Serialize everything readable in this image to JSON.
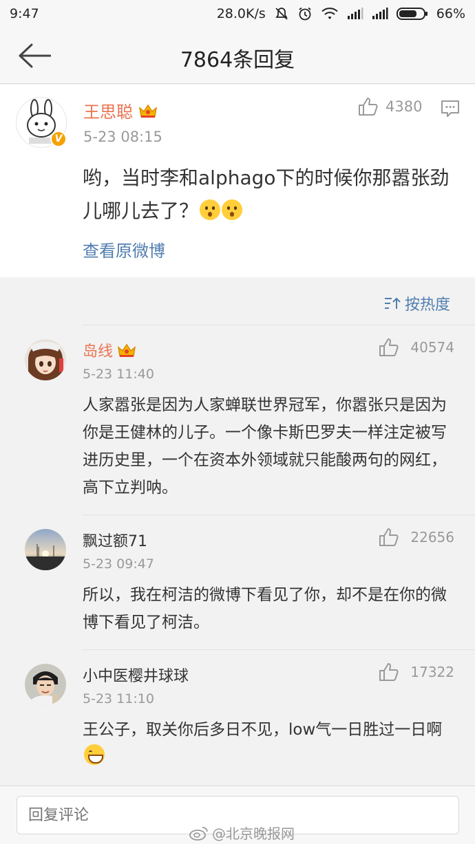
{
  "status_bar": {
    "time": "9:47",
    "network_speed": "28.0K/s",
    "battery": "66%"
  },
  "nav": {
    "title": "7864条回复"
  },
  "original_post": {
    "username": "王思聪",
    "time": "5-23 08:15",
    "likes": "4380",
    "text": "哟，当时李和alphago下的时候你那嚣张劲儿哪儿去了？",
    "view_original": "查看原微博",
    "verified_badge": "V"
  },
  "sort": {
    "label": "按热度"
  },
  "comments": [
    {
      "username": "岛线",
      "time": "5-23 11:40",
      "likes": "40574",
      "text": "人家嚣张是因为人家蝉联世界冠军，你嚣张只是因为你是王健林的儿子。一个像卡斯巴罗夫一样注定被写进历史里，一个在资本外领域就只能酸两句的网红，高下立判呐。"
    },
    {
      "username": "飘过额71",
      "time": "5-23 09:47",
      "likes": "22656",
      "text": "所以，我在柯洁的微博下看见了你，却不是在你的微博下看见了柯洁。"
    },
    {
      "username": "小中医樱井球球",
      "time": "5-23 11:10",
      "likes": "17322",
      "text": "王公子，取关你后多日不见，low气一日胜过一日啊"
    }
  ],
  "bottom": {
    "reply_placeholder": "回复评论"
  },
  "watermark": "@北京晚报网",
  "colors": {
    "accent_orange": "#eb7350",
    "link_blue": "#507daf",
    "muted": "#999999"
  }
}
